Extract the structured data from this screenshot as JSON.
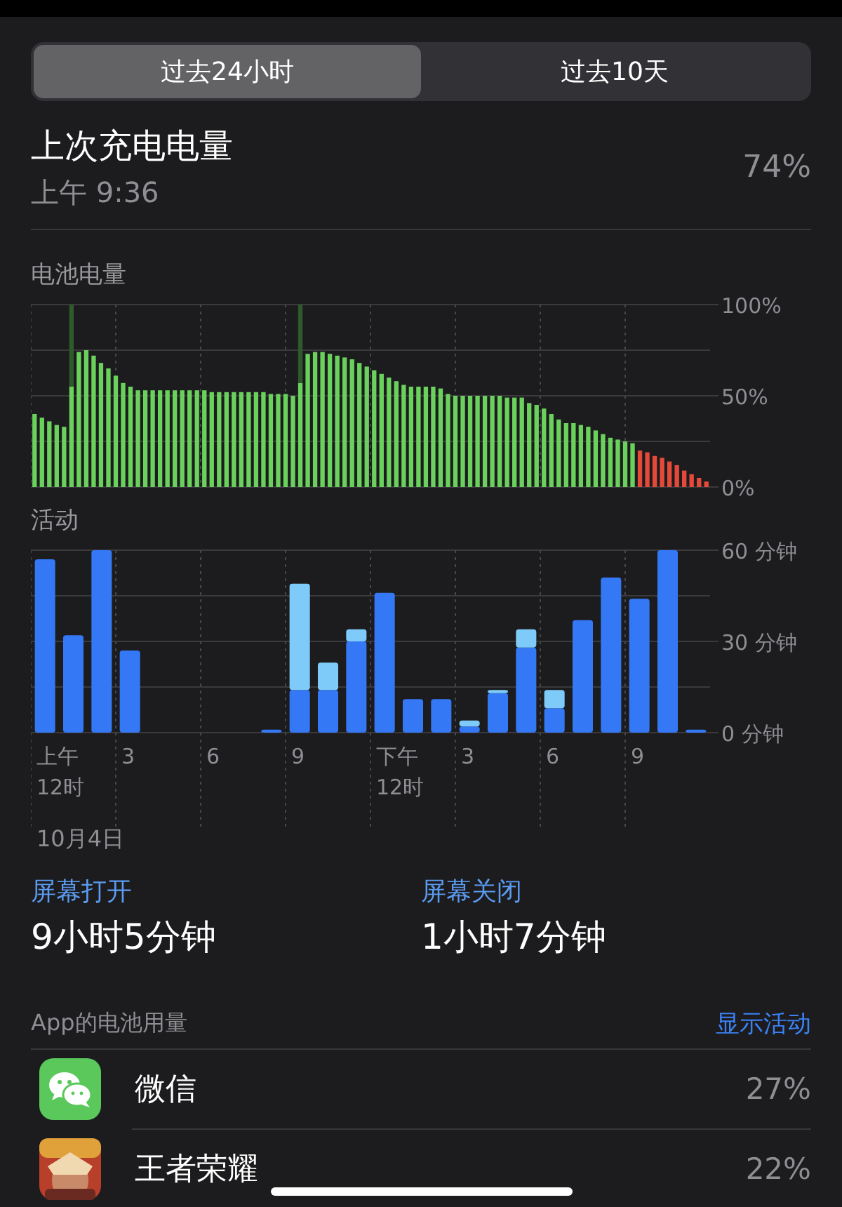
{
  "tabs": [
    {
      "label": "过去24小时",
      "selected": true
    },
    {
      "label": "过去10天",
      "selected": false
    }
  ],
  "last_charge": {
    "title": "上次充电电量",
    "time": "上午 9:36",
    "value": "74%"
  },
  "battery_level": {
    "title": "电池电量",
    "chart_data": {
      "type": "bar",
      "grid": true,
      "ylim": [
        0,
        100
      ],
      "yticks": [
        {
          "value": 0,
          "label": "0%"
        },
        {
          "value": 50,
          "label": "50%"
        },
        {
          "value": 100,
          "label": "100%"
        }
      ],
      "stacked": true,
      "series": [
        {
          "color": "#6ad25c",
          "values": [
            40,
            38,
            36,
            34,
            33,
            55,
            74,
            75,
            72,
            68,
            65,
            61,
            57,
            55,
            53,
            53,
            53,
            53,
            53,
            53,
            53,
            53,
            53,
            53,
            52,
            52,
            52,
            52,
            52,
            52,
            52,
            52,
            51,
            51,
            51,
            50,
            57,
            73,
            74,
            74,
            73,
            72,
            71,
            70,
            68,
            66,
            64,
            62,
            60,
            58,
            56,
            55,
            55,
            55,
            55,
            54,
            51,
            50,
            50,
            50,
            50,
            50,
            50,
            50,
            49,
            49,
            49,
            46,
            45,
            43,
            40,
            37,
            35,
            35,
            34,
            33,
            31,
            29,
            27,
            26,
            25,
            24,
            null,
            null,
            null,
            null,
            null,
            null,
            null,
            null,
            null,
            null
          ]
        },
        {
          "color": "#e5493a",
          "values": [
            null,
            null,
            null,
            null,
            null,
            null,
            null,
            null,
            null,
            null,
            null,
            null,
            null,
            null,
            null,
            null,
            null,
            null,
            null,
            null,
            null,
            null,
            null,
            null,
            null,
            null,
            null,
            null,
            null,
            null,
            null,
            null,
            null,
            null,
            null,
            null,
            null,
            null,
            null,
            null,
            null,
            null,
            null,
            null,
            null,
            null,
            null,
            null,
            null,
            null,
            null,
            null,
            null,
            null,
            null,
            null,
            null,
            null,
            null,
            null,
            null,
            null,
            null,
            null,
            null,
            null,
            null,
            null,
            null,
            null,
            null,
            null,
            null,
            null,
            null,
            null,
            null,
            null,
            null,
            null,
            null,
            null,
            20,
            19,
            17,
            16,
            14,
            12,
            9,
            7,
            5,
            3
          ]
        },
        {
          "color": "#2f5a2c",
          "values": [
            null,
            null,
            null,
            null,
            null,
            45,
            null,
            null,
            null,
            null,
            null,
            null,
            null,
            null,
            null,
            null,
            null,
            null,
            null,
            null,
            null,
            null,
            null,
            null,
            null,
            null,
            null,
            null,
            null,
            null,
            null,
            null,
            null,
            null,
            null,
            null,
            43,
            null,
            null,
            null,
            null,
            null,
            null,
            null,
            null,
            null,
            null,
            null,
            null,
            null,
            null,
            null,
            null,
            null,
            null,
            null,
            null,
            null,
            null,
            null,
            null,
            null,
            null,
            null,
            null,
            null,
            null,
            null,
            null,
            null,
            null,
            null,
            null,
            null,
            null,
            null,
            null,
            null,
            null,
            null,
            null,
            null,
            null,
            null,
            null,
            null,
            null,
            null,
            null,
            null,
            null,
            null
          ]
        }
      ]
    }
  },
  "activity": {
    "title": "活动",
    "time_labels": [
      "上午\n12时",
      "3",
      "6",
      "9",
      "下午\n12时",
      "3",
      "6",
      "9"
    ],
    "date": "10月4日",
    "chart_data": {
      "type": "bar",
      "grid": true,
      "stacked": true,
      "ylim": [
        0,
        60
      ],
      "yticks": [
        {
          "value": 0,
          "label": "0 分钟"
        },
        {
          "value": 30,
          "label": "30 分钟"
        },
        {
          "value": 60,
          "label": "60 分钟"
        }
      ],
      "series": [
        {
          "color": "#3478f6",
          "values": [
            57,
            32,
            60,
            27,
            0,
            0,
            0,
            0,
            1,
            14,
            14,
            30,
            46,
            11,
            11,
            2,
            13,
            28,
            8,
            37,
            51,
            44,
            60,
            1
          ]
        },
        {
          "color": "#7ecbfa",
          "values": [
            0,
            0,
            0,
            0,
            0,
            0,
            0,
            0,
            0,
            35,
            9,
            4,
            0,
            0,
            0,
            2,
            1,
            6,
            6,
            0,
            0,
            0,
            0,
            0
          ]
        }
      ]
    }
  },
  "screen_time": [
    {
      "label": "屏幕打开",
      "value": "9小时5分钟"
    },
    {
      "label": "屏幕关闭",
      "value": "1小时7分钟"
    }
  ],
  "app_usage": {
    "title": "App的电池用量",
    "action": "显示活动",
    "apps": [
      {
        "kind": "chat",
        "name": "微信",
        "percent": "27%"
      },
      {
        "kind": "game",
        "name": "王者荣耀",
        "percent": "22%"
      }
    ]
  }
}
